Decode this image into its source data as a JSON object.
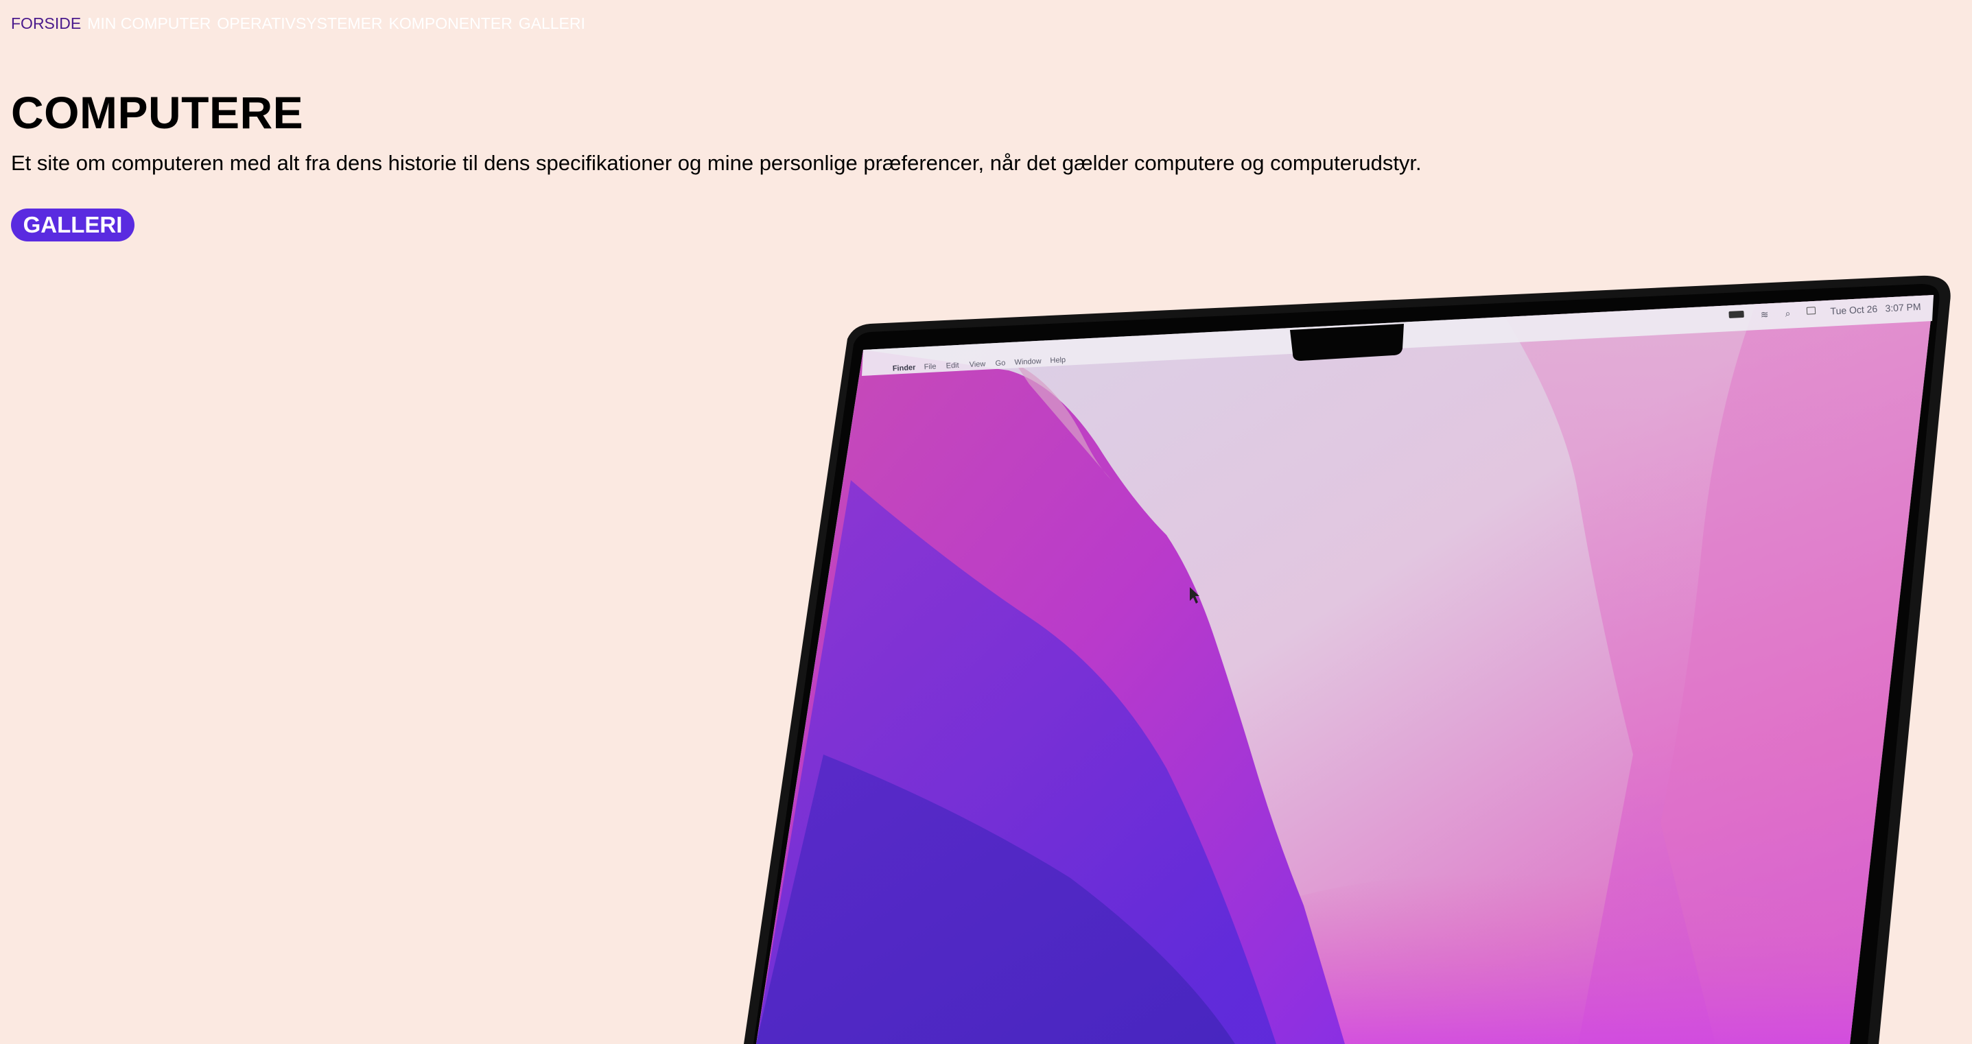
{
  "nav": {
    "items": [
      {
        "label": "FORSIDE",
        "active": true
      },
      {
        "label": "MIN COMPUTER",
        "active": false
      },
      {
        "label": "OPERATIVSYSTEMER",
        "active": false
      },
      {
        "label": "KOMPONENTER",
        "active": false
      },
      {
        "label": "GALLERI",
        "active": false
      }
    ]
  },
  "hero": {
    "title": "COMPUTERE",
    "text": "Et site om computeren med alt fra dens historie til dens specifikationer og mine personlige præferencer, når det gælder computere og computerudstyr.",
    "button_label": "GALLERI"
  },
  "laptop_screen": {
    "menubar": {
      "items": [
        "Finder",
        "File",
        "Edit",
        "View",
        "Go",
        "Window",
        "Help"
      ],
      "date": "Tue Oct 26",
      "time": "3:07 PM"
    }
  },
  "colors": {
    "background": "#fbe9e1",
    "accent": "#5a2be0",
    "nav_active": "#4a1a8c",
    "nav_text": "#ffffff"
  }
}
